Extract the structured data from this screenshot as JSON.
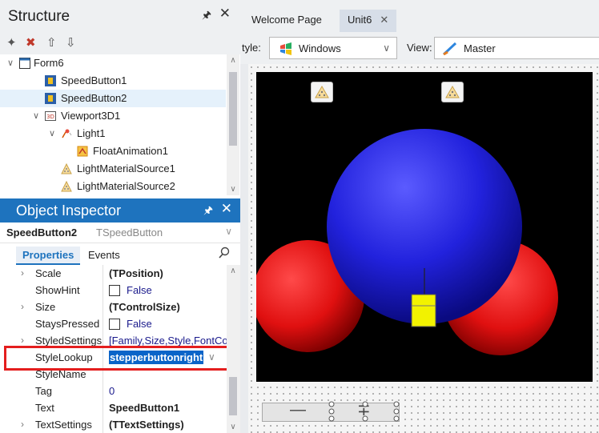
{
  "structure": {
    "title": "Structure",
    "tree": [
      {
        "label": "Form6",
        "icon": "form-icon",
        "toggle": "expanded"
      },
      {
        "label": "SpeedButton1",
        "icon": "speedbutton-icon"
      },
      {
        "label": "SpeedButton2",
        "icon": "speedbutton-icon",
        "selected": true
      },
      {
        "label": "Viewport3D1",
        "icon": "viewport3d-icon",
        "toggle": "expanded"
      },
      {
        "label": "Light1",
        "icon": "light-icon",
        "toggle": "expanded"
      },
      {
        "label": "FloatAnimation1",
        "icon": "animation-icon"
      },
      {
        "label": "LightMaterialSource1",
        "icon": "material-icon"
      },
      {
        "label": "LightMaterialSource2",
        "icon": "material-icon"
      }
    ]
  },
  "object_inspector": {
    "title": "Object Inspector",
    "selected_name": "SpeedButton2",
    "selected_class": "TSpeedButton",
    "tabs": [
      "Properties",
      "Events"
    ],
    "active_tab": "Properties",
    "properties": [
      {
        "name": "Scale",
        "value": "(TPosition)",
        "expandable": true,
        "style": "bold"
      },
      {
        "name": "ShowHint",
        "value": "False",
        "checkbox": true
      },
      {
        "name": "Size",
        "value": "(TControlSize)",
        "expandable": true,
        "style": "bold"
      },
      {
        "name": "StaysPressed",
        "value": "False",
        "checkbox": true
      },
      {
        "name": "StyledSettings",
        "value": "[Family,Size,Style,FontCo",
        "expandable": true,
        "style": "blue"
      },
      {
        "name": "StyleLookup",
        "value": "stepperbuttonright",
        "highlighted": true
      },
      {
        "name": "StyleName",
        "value": ""
      },
      {
        "name": "Tag",
        "value": "0",
        "style": "blue"
      },
      {
        "name": "Text",
        "value": "SpeedButton1",
        "style": "bold"
      },
      {
        "name": "TextSettings",
        "value": "(TTextSettings)",
        "expandable": true,
        "style": "bold"
      }
    ]
  },
  "designer": {
    "tabs": [
      {
        "label": "Welcome Page"
      },
      {
        "label": "Unit6",
        "active": true
      }
    ],
    "style_label": "tyle:",
    "style_value": "Windows",
    "view_label": "View:",
    "view_value": "Master"
  },
  "scene": {
    "sphere_center_color": "#2222dd",
    "sphere_side_color": "#e01010",
    "cube_color": "#f2f200",
    "background": "#000000"
  },
  "colors": {
    "accent": "#1e73be",
    "highlight_border": "#e41e1e",
    "selection": "#0a64c8"
  }
}
